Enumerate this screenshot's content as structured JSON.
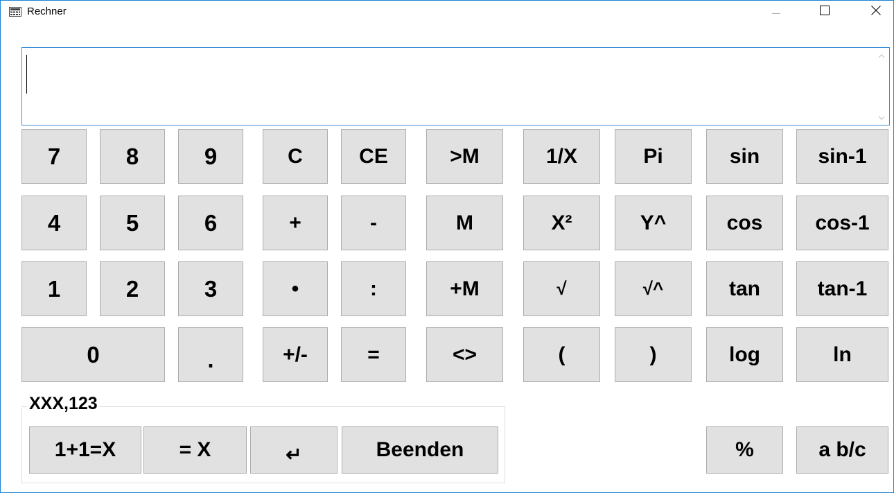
{
  "window": {
    "title": "Rechner",
    "colors": {
      "border": "#1883d7",
      "key_bg": "#e1e1e1",
      "key_border": "#adadad",
      "display_border": "#3c8fd6"
    }
  },
  "display": {
    "value": ""
  },
  "keys": {
    "row1": [
      "7",
      "8",
      "9",
      "C",
      "CE",
      ">M",
      "1/X",
      "Pi",
      "sin",
      "sin-1"
    ],
    "row2": [
      "4",
      "5",
      "6",
      "+",
      "-",
      "M",
      "X²",
      "Y^",
      "cos",
      "cos-1"
    ],
    "row3": [
      "1",
      "2",
      "3",
      "•",
      ":",
      "+M",
      "√",
      "√^",
      "tan",
      "tan-1"
    ],
    "row4": [
      "0",
      ".",
      "+/-",
      "=",
      "<>",
      "(",
      ")",
      "log",
      "ln"
    ]
  },
  "format_group": {
    "label": "XXX,123",
    "buttons": [
      "1+1=X",
      "= X",
      "↵",
      "Beenden"
    ]
  },
  "extra": {
    "percent": "%",
    "fraction": "a b/c"
  },
  "icons": {
    "app": "calculator-icon",
    "minimize": "minimize-icon",
    "maximize": "maximize-icon",
    "close": "close-icon"
  }
}
